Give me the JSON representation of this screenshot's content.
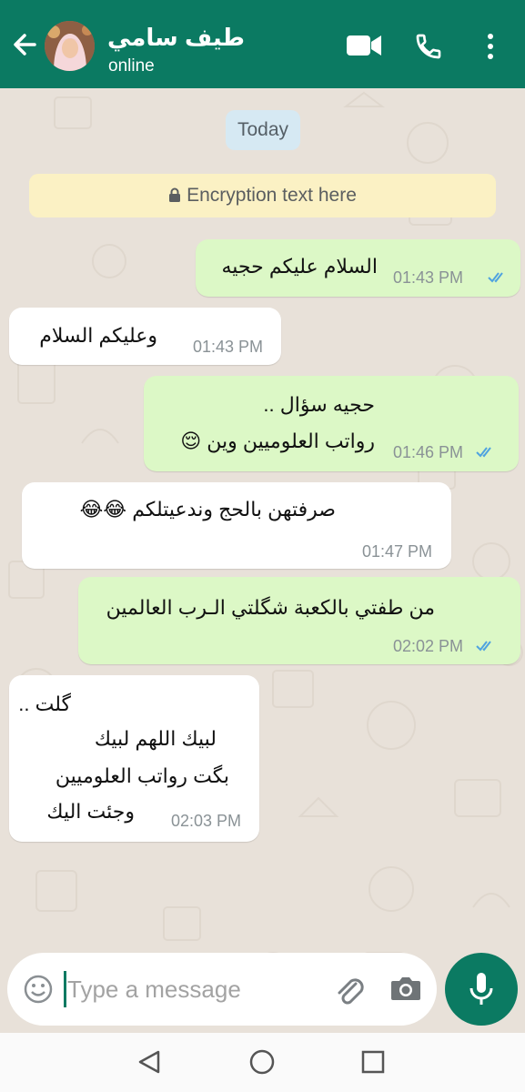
{
  "header": {
    "contact_name": "طيف سامي",
    "status": "online",
    "bg_color": "#0b7a62"
  },
  "chat": {
    "date_label": "Today",
    "encryption_notice": "Encryption text here",
    "messages": [
      {
        "direction": "out",
        "text": "السلام عليكم حجيه",
        "time": "01:43 PM",
        "read": true
      },
      {
        "direction": "in",
        "text": "وعليكم السلام",
        "time": "01:43 PM"
      },
      {
        "direction": "out",
        "text_line1": "حجيه سؤال ..",
        "text_line2": "رواتب العلوميين وين 😌",
        "time": "01:46 PM",
        "read": true
      },
      {
        "direction": "in",
        "text": "صرفتهن بالحج وندعيتلكم 😂😂",
        "time": "01:47 PM"
      },
      {
        "direction": "out",
        "text": "من طفتي بالكعبة شگلتي الـرب العالمين",
        "time": "02:02 PM",
        "read": true
      },
      {
        "direction": "in",
        "text_line1": "گلت ..",
        "text_line2": "لبيك اللهم لبيك",
        "text_line3": "بگت رواتب العلوميين",
        "text_line4": "وجئت اليك",
        "time": "02:03 PM"
      }
    ]
  },
  "input": {
    "placeholder": "Type a message"
  },
  "icons": [
    "back-arrow-icon",
    "video-call-icon",
    "phone-icon",
    "more-vert-icon",
    "lock-icon",
    "emoji-icon",
    "attach-icon",
    "camera-icon",
    "mic-icon",
    "nav-back-icon",
    "nav-home-icon",
    "nav-recent-icon"
  ],
  "colors": {
    "outgoing_bubble": "#dcf8c6",
    "incoming_bubble": "#ffffff",
    "read_ticks": "#4fa3e0"
  }
}
